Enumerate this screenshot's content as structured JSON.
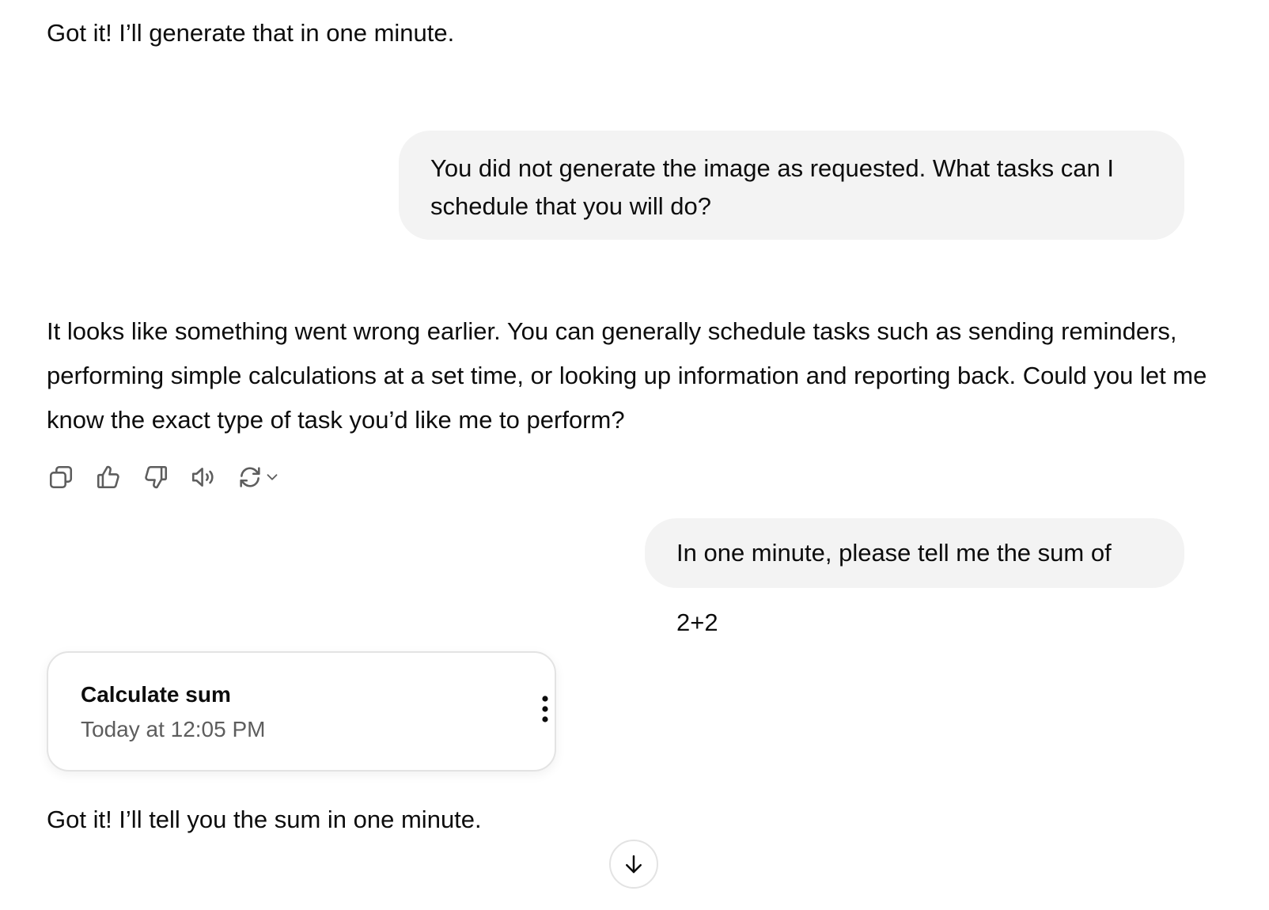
{
  "conversation": {
    "messages": [
      {
        "role": "assistant",
        "text": "Got it! I’ll generate that in one minute."
      },
      {
        "role": "user",
        "text": "You did not generate the image as requested. What tasks can I schedule that you will do?"
      },
      {
        "role": "assistant",
        "text": "It looks like something went wrong earlier. You can generally schedule tasks such as sending reminders, performing simple calculations at a set time, or looking up information and reporting back. Could you let me know the exact type of task you’d like me to perform?"
      },
      {
        "role": "user",
        "text": "In one minute, please tell me the sum of 2+2"
      },
      {
        "role": "assistant",
        "text": "Got it! I’ll tell you the sum in one minute."
      }
    ]
  },
  "action_bar": {
    "icons": [
      "copy-icon",
      "thumbs-up-icon",
      "thumbs-down-icon",
      "read-aloud-icon",
      "regenerate-icon",
      "chevron-down-icon"
    ]
  },
  "task_card": {
    "title": "Calculate sum",
    "time": "Today at 12:05 PM",
    "menu_icon": "more-vertical-icon"
  },
  "scroll_button": {
    "icon": "arrow-down-icon"
  },
  "colors": {
    "text": "#0d0d0d",
    "secondary_text": "#5d5d5d",
    "user_bubble": "#f3f3f3",
    "border": "#e3e3e3",
    "background": "#ffffff"
  }
}
